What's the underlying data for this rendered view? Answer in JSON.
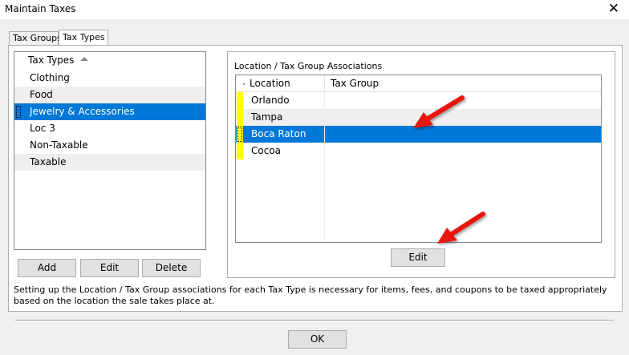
{
  "window": {
    "title": "Maintain Taxes",
    "close_glyph": "✕"
  },
  "tabs": [
    {
      "label": "Tax Groups"
    },
    {
      "label": "Tax Types"
    }
  ],
  "tax_types": {
    "header": "Tax Types",
    "items": [
      {
        "label": "Clothing"
      },
      {
        "label": "Food"
      },
      {
        "label": "Jewelry & Accessories"
      },
      {
        "label": "Loc 3"
      },
      {
        "label": "Non-Taxable"
      },
      {
        "label": "Taxable"
      }
    ],
    "selected_index": 2,
    "buttons": {
      "add": "Add",
      "edit": "Edit",
      "delete": "Delete"
    }
  },
  "associations": {
    "group_label": "Location / Tax Group Associations",
    "columns": {
      "location": "Location",
      "tax_group": "Tax Group"
    },
    "rows": [
      {
        "location": "Orlando",
        "tax_group": ""
      },
      {
        "location": "Tampa",
        "tax_group": ""
      },
      {
        "location": "Boca Raton",
        "tax_group": ""
      },
      {
        "location": "Cocoa",
        "tax_group": ""
      }
    ],
    "selected_index": 2,
    "edit_button": "Edit"
  },
  "note": "Setting up the Location / Tax Group associations for each Tax Type is necessary for items, fees, and coupons to be taxed appropriately based on the location the sale takes place at.",
  "footer": {
    "ok_button": "OK"
  },
  "colors": {
    "selection": "#0078d7",
    "indicator": "#ffff00",
    "annotation_arrow": "#e8120c"
  }
}
